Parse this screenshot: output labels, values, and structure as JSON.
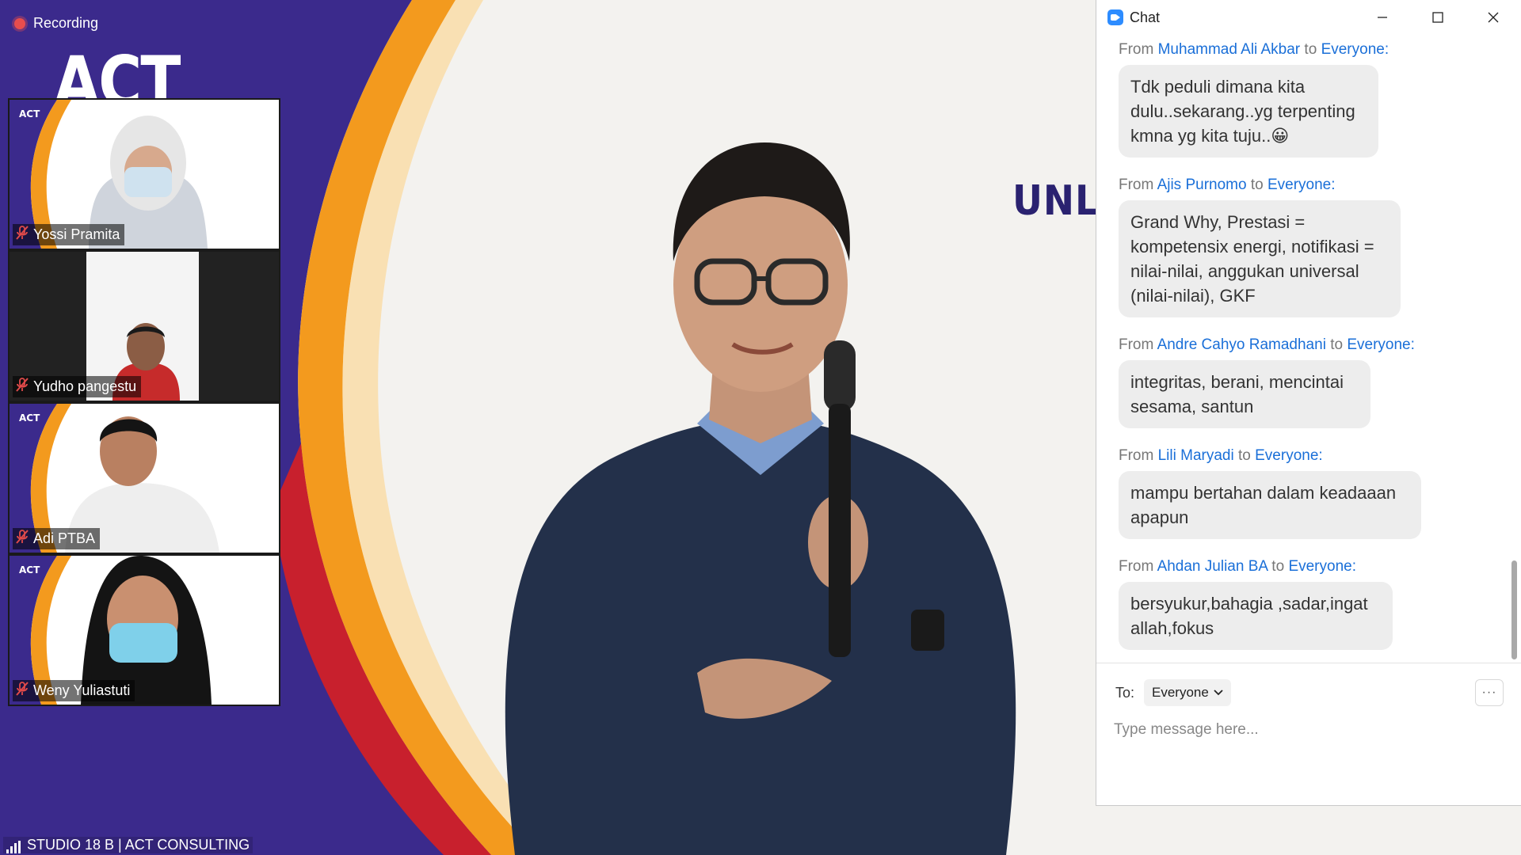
{
  "recording": {
    "label": "Recording"
  },
  "stage": {
    "logo_text": "ACT",
    "slide_text": "UNLOC",
    "footer_label": "STUDIO 18 B | ACT CONSULTING"
  },
  "participants": [
    {
      "name": "Yossi Pramita",
      "muted": true
    },
    {
      "name": "Yudho pangestu",
      "muted": true
    },
    {
      "name": "Adi PTBA",
      "muted": true
    },
    {
      "name": "Weny Yuliastuti",
      "muted": true
    }
  ],
  "chat": {
    "title": "Chat",
    "messages": [
      {
        "from_prefix": "From",
        "sender": "Muhammad Ali Akbar",
        "to_word": "to",
        "recipient": "Everyone",
        "colon": ":",
        "text": "Tdk peduli dimana kita dulu..sekarang..yg terpenting kmna yg kita tuju..😀"
      },
      {
        "from_prefix": "From",
        "sender": "Ajis Purnomo",
        "to_word": "to",
        "recipient": "Everyone",
        "colon": ":",
        "text": "Grand Why, Prestasi = kompetensix energi, notifikasi = nilai-nilai, anggukan universal (nilai-nilai), GKF"
      },
      {
        "from_prefix": "From",
        "sender": "Andre Cahyo Ramadhani",
        "to_word": "to",
        "recipient": "Everyone",
        "colon": ":",
        "text": "integritas, berani, mencintai sesama, santun"
      },
      {
        "from_prefix": "From",
        "sender": "Lili Maryadi",
        "to_word": "to",
        "recipient": "Everyone",
        "colon": ":",
        "text": "mampu bertahan dalam keadaaan apapun"
      },
      {
        "from_prefix": "From",
        "sender": "Ahdan Julian BA",
        "to_word": "to",
        "recipient": "Everyone",
        "colon": ":",
        "text": "bersyukur,bahagia ,sadar,ingat allah,fokus"
      }
    ],
    "compose": {
      "to_label": "To:",
      "recipient_value": "Everyone",
      "more_label": "···",
      "placeholder": "Type message here..."
    }
  },
  "colors": {
    "purple": "#3b2a8c",
    "orange": "#f39a1e",
    "red": "#c8202d",
    "link_blue": "#1a6fd8",
    "bubble_gray": "#ededed",
    "zoom_blue": "#2d8cff"
  },
  "icons": {
    "record": "record-icon",
    "mic_off": "mic-off-icon",
    "signal": "signal-bars-icon",
    "chat_app": "zoom-icon",
    "minimize": "minimize-icon",
    "maximize": "maximize-icon",
    "close": "close-icon",
    "dropdown": "chevron-down-icon",
    "more": "more-icon"
  }
}
